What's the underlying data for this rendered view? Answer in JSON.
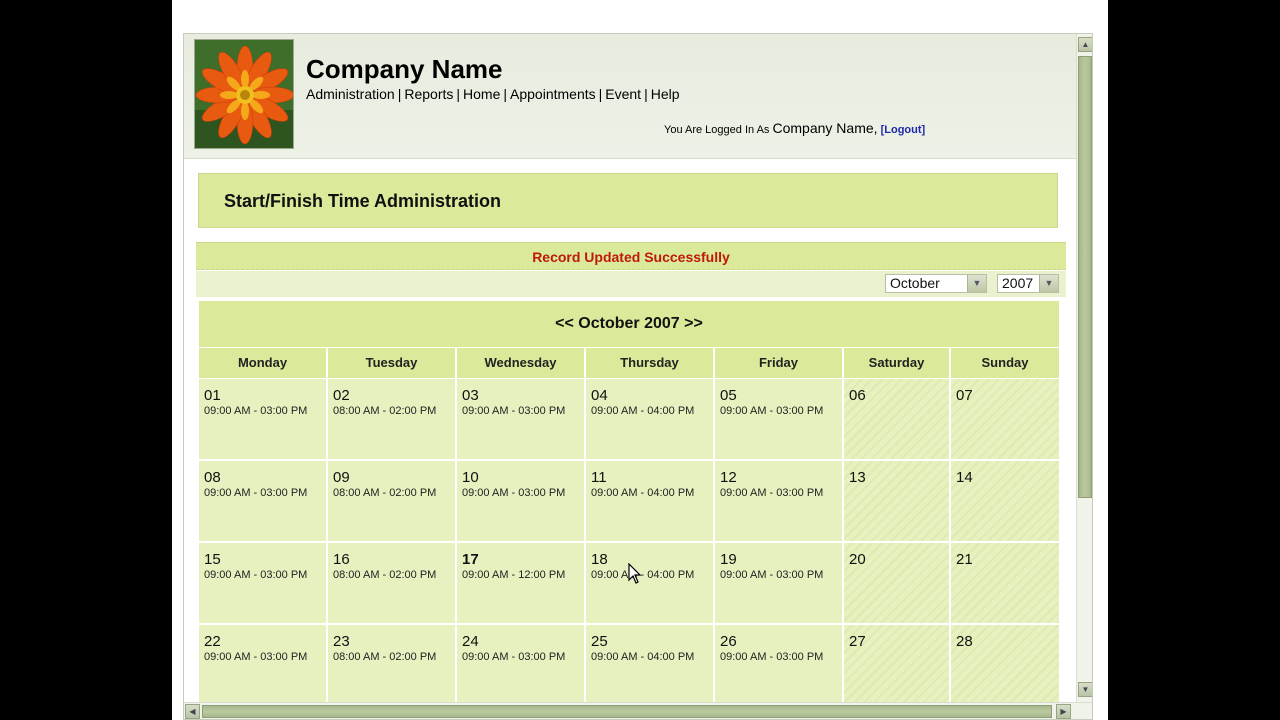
{
  "header": {
    "company_name": "Company Name",
    "nav": [
      "Administration",
      "Reports",
      "Home",
      "Appointments",
      "Event",
      "Help"
    ],
    "nav_separator": "|",
    "login_prefix": "You Are Logged In As",
    "login_user": "Company Name,",
    "logout_label": "[Logout]"
  },
  "page": {
    "title": "Start/Finish Time Administration",
    "status_message": "Record Updated Successfully",
    "month_select": "October",
    "year_select": "2007"
  },
  "calendar": {
    "heading": "<< October 2007 >>",
    "days": [
      "Monday",
      "Tuesday",
      "Wednesday",
      "Thursday",
      "Friday",
      "Saturday",
      "Sunday"
    ],
    "weeks": [
      [
        {
          "day": "01",
          "time": "09:00 AM - 03:00 PM"
        },
        {
          "day": "02",
          "time": "08:00 AM - 02:00 PM"
        },
        {
          "day": "03",
          "time": "09:00 AM - 03:00 PM"
        },
        {
          "day": "04",
          "time": "09:00 AM - 04:00 PM"
        },
        {
          "day": "05",
          "time": "09:00 AM - 03:00 PM"
        },
        {
          "day": "06",
          "time": ""
        },
        {
          "day": "07",
          "time": ""
        }
      ],
      [
        {
          "day": "08",
          "time": "09:00 AM - 03:00 PM"
        },
        {
          "day": "09",
          "time": "08:00 AM - 02:00 PM"
        },
        {
          "day": "10",
          "time": "09:00 AM - 03:00 PM"
        },
        {
          "day": "11",
          "time": "09:00 AM - 04:00 PM"
        },
        {
          "day": "12",
          "time": "09:00 AM - 03:00 PM"
        },
        {
          "day": "13",
          "time": ""
        },
        {
          "day": "14",
          "time": ""
        }
      ],
      [
        {
          "day": "15",
          "time": "09:00 AM - 03:00 PM"
        },
        {
          "day": "16",
          "time": "08:00 AM - 02:00 PM"
        },
        {
          "day": "17",
          "time": "09:00 AM - 12:00 PM",
          "today": true
        },
        {
          "day": "18",
          "time": "09:00 AM - 04:00 PM"
        },
        {
          "day": "19",
          "time": "09:00 AM - 03:00 PM"
        },
        {
          "day": "20",
          "time": ""
        },
        {
          "day": "21",
          "time": ""
        }
      ],
      [
        {
          "day": "22",
          "time": "09:00 AM - 03:00 PM"
        },
        {
          "day": "23",
          "time": "08:00 AM - 02:00 PM"
        },
        {
          "day": "24",
          "time": "09:00 AM - 03:00 PM"
        },
        {
          "day": "25",
          "time": "09:00 AM - 04:00 PM"
        },
        {
          "day": "26",
          "time": "09:00 AM - 03:00 PM"
        },
        {
          "day": "27",
          "time": ""
        },
        {
          "day": "28",
          "time": ""
        }
      ]
    ]
  },
  "icons": {
    "logo": "gazania-flower-logo",
    "cursor": "mouse-pointer-icon"
  },
  "colors": {
    "accent_green": "#daea9a",
    "cell_green": "#e6f1bf",
    "status_red": "#c0180c",
    "logout_blue": "#1f2aa8"
  }
}
